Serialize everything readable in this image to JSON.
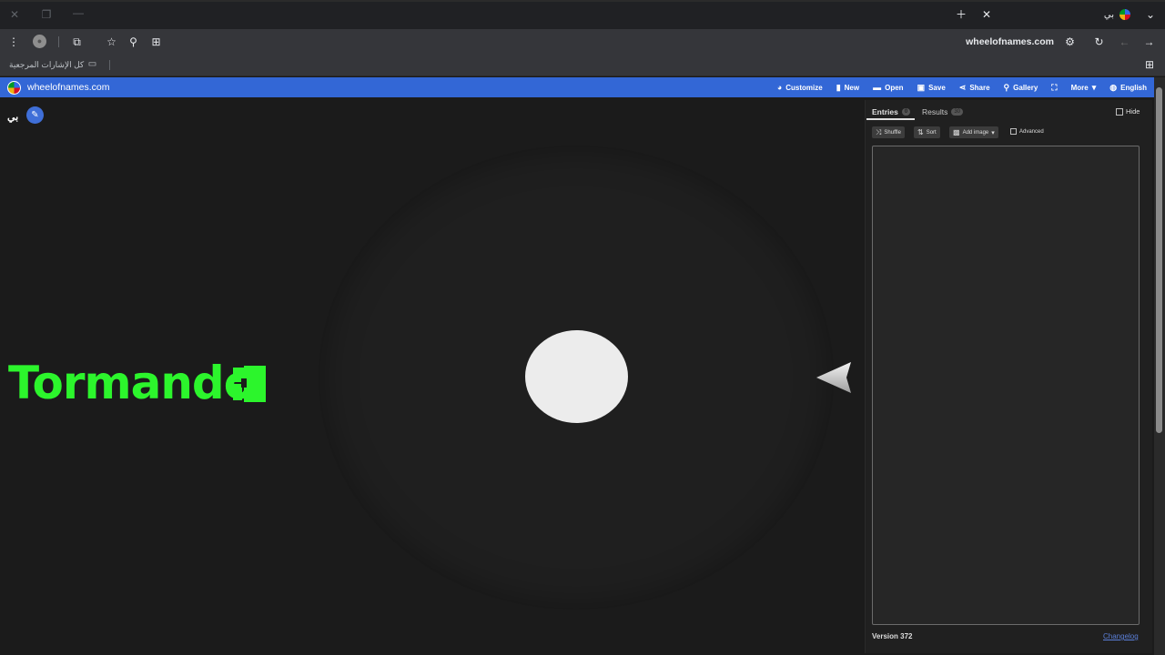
{
  "browser": {
    "tab_title": "بي",
    "url": "wheelofnames.com",
    "bookmarks_label": "كل الإشارات المرجعية"
  },
  "app": {
    "brand": "wheelofnames.com",
    "menu": [
      {
        "label": "Customize",
        "icon": "palette-icon"
      },
      {
        "label": "New",
        "icon": "file-icon"
      },
      {
        "label": "Open",
        "icon": "folder-icon"
      },
      {
        "label": "Save",
        "icon": "save-icon"
      },
      {
        "label": "Share",
        "icon": "share-icon"
      },
      {
        "label": "Gallery",
        "icon": "search-icon"
      },
      {
        "label": "",
        "icon": "fullscreen-icon"
      },
      {
        "label": "More",
        "icon": "chevron-down-icon"
      },
      {
        "label": "English",
        "icon": "globe-icon"
      }
    ],
    "wheel_title": "بي",
    "spin_status": "Tormando"
  },
  "panel": {
    "tabs": [
      {
        "label": "Entries",
        "count": "0"
      },
      {
        "label": "Results",
        "count": "30"
      }
    ],
    "hide_label": "Hide",
    "tools": {
      "shuffle": "Shuffle",
      "sort": "Sort",
      "add_image": "Add image",
      "advanced": "Advanced"
    },
    "version": "Version 372",
    "changelog": "Changelog"
  },
  "colors": {
    "accent": "#3367d6",
    "spin_text": "#2cf52c",
    "background": "#1b1b1b"
  }
}
